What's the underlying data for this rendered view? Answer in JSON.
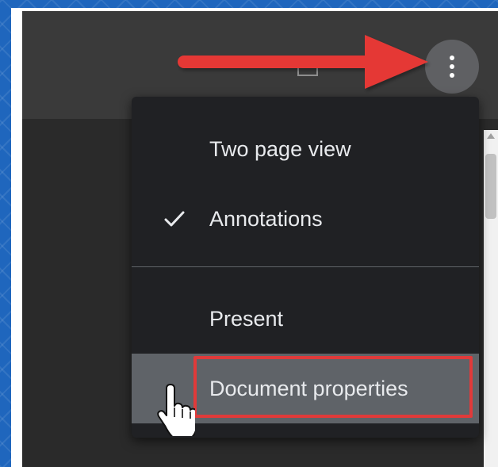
{
  "menu": {
    "items": [
      {
        "label": "Two page view",
        "checked": false
      },
      {
        "label": "Annotations",
        "checked": true
      },
      {
        "label": "Present",
        "checked": false
      },
      {
        "label": "Document properties",
        "checked": false,
        "highlighted": true
      }
    ]
  },
  "toolbar": {
    "more_button_icon": "more-vertical-icon"
  },
  "annotation": {
    "arrow_color": "#e53935",
    "box_color": "#e03a3a"
  },
  "colors": {
    "menu_bg": "#202124",
    "menu_text": "#e8eaed",
    "highlight_bg": "#5f6368",
    "page_bg": "#1f66bd"
  }
}
